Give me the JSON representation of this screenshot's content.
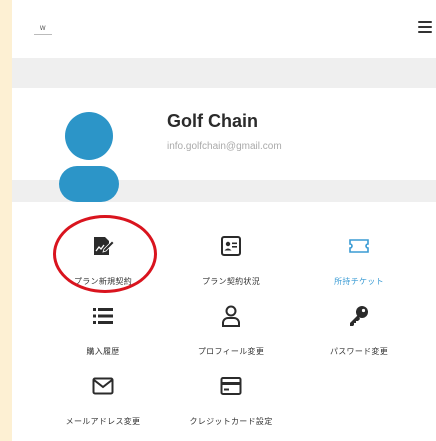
{
  "header": {
    "logo_text": "W",
    "menu_icon": "hamburger-icon"
  },
  "profile": {
    "name": "Golf Chain",
    "email": "info.golfchain@gmail.com",
    "avatar_icon": "user-avatar-icon",
    "avatar_color": "#2c95c8"
  },
  "menu_items": [
    {
      "label": "プラン新規契約",
      "icon": "contract-edit-icon"
    },
    {
      "label": "プラン契約状況",
      "icon": "id-card-icon"
    },
    {
      "label": "所持チケット",
      "icon": "ticket-icon"
    },
    {
      "label": "購入履歴",
      "icon": "list-icon"
    },
    {
      "label": "プロフィール変更",
      "icon": "person-icon"
    },
    {
      "label": "パスワード変更",
      "icon": "key-icon"
    },
    {
      "label": "メールアドレス変更",
      "icon": "mail-icon"
    },
    {
      "label": "クレジットカード設定",
      "icon": "credit-card-icon"
    }
  ],
  "colors": {
    "outer_background": "#fdf0d3",
    "accent_blue": "#3a9bd4",
    "highlight_circle": "#d9141e"
  }
}
